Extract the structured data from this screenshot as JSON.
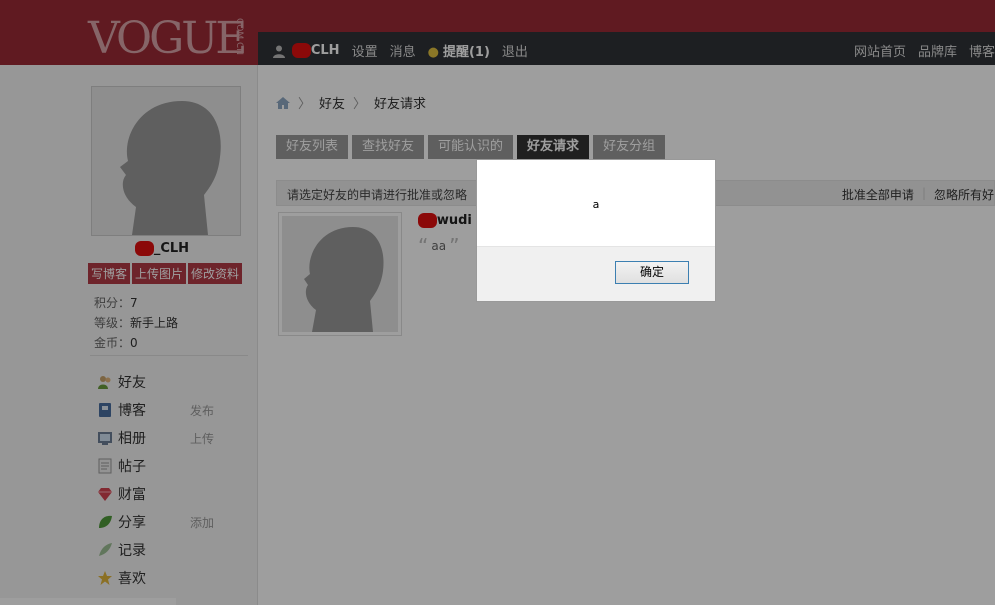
{
  "header": {
    "logo": "VOGUE",
    "logo_sub": "COM.CN",
    "user_name": "CLH",
    "nav_left": [
      "设置",
      "消息",
      "提醒(1)",
      "退出"
    ],
    "nav_right": [
      "网站首页",
      "品牌库",
      "博客"
    ]
  },
  "sidebar": {
    "profile_name": "_CLH",
    "actions": [
      "写博客",
      "上传图片",
      "修改资料"
    ],
    "stats": [
      {
        "label": "积分：",
        "value": "7"
      },
      {
        "label": "等级：",
        "value": "新手上路"
      },
      {
        "label": "金币：",
        "value": "0"
      }
    ],
    "menu": [
      {
        "label": "好友",
        "extra": "",
        "icon": "friends-icon"
      },
      {
        "label": "博客",
        "extra": "发布",
        "icon": "blog-icon"
      },
      {
        "label": "相册",
        "extra": "上传",
        "icon": "album-icon"
      },
      {
        "label": "帖子",
        "extra": "",
        "icon": "post-icon"
      },
      {
        "label": "财富",
        "extra": "",
        "icon": "wealth-icon"
      },
      {
        "label": "分享",
        "extra": "添加",
        "icon": "share-icon"
      },
      {
        "label": "记录",
        "extra": "",
        "icon": "record-icon"
      },
      {
        "label": "喜欢",
        "extra": "",
        "icon": "star-icon"
      }
    ]
  },
  "breadcrumb": [
    "好友",
    "好友请求"
  ],
  "tabs": [
    "好友列表",
    "查找好友",
    "可能认识的",
    "好友请求",
    "好友分组"
  ],
  "active_tab": 3,
  "info_bar": {
    "text": "请选定好友的申请进行批准或忽略",
    "actions": [
      "批准全部申请",
      "忽略所有好"
    ]
  },
  "request": {
    "name": "wudi",
    "message": "aa"
  },
  "dialog": {
    "message": "a",
    "ok_label": "确定"
  },
  "colors": {
    "brand": "#9c2a36",
    "navbar": "#2f3338",
    "action_button": "#b23a46",
    "active_tab": "#333333"
  }
}
